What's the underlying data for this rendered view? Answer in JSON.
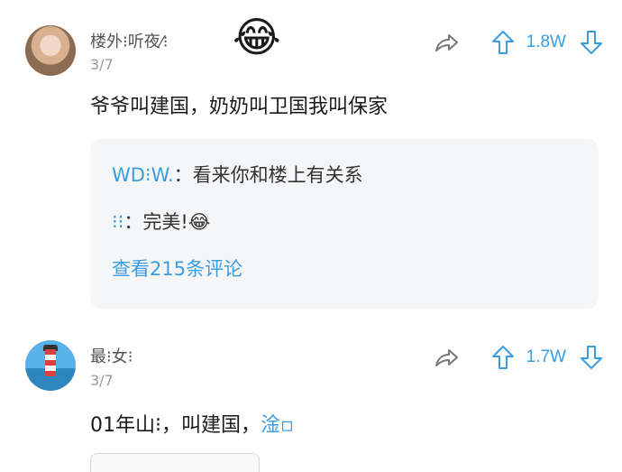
{
  "comments": [
    {
      "user": "楼外⁝听夜⁄⁝",
      "date": "3/7",
      "emoji": "😂",
      "count": "1.8W",
      "text": "爷爷叫建国，奶奶叫卫国我叫保家",
      "replies": [
        {
          "name": "WD⁝W.",
          "sep": "：",
          "text": "看来你和楼上有关系"
        },
        {
          "name": "⁝⁝",
          "sep": "：",
          "text": "完美!😂"
        }
      ],
      "more_link": "查看215条评论"
    },
    {
      "user": "最⁝女⁝",
      "date": "3/7",
      "count": "1.7W",
      "text": "01年山⁝，叫建国，",
      "text_tail": "淦▫"
    }
  ],
  "icons": {
    "share": "share-icon",
    "upvote": "upvote-arrow-icon",
    "downvote": "downvote-arrow-icon"
  },
  "colors": {
    "accent": "#3a9de0",
    "reply_bg": "#f5f6f8"
  }
}
